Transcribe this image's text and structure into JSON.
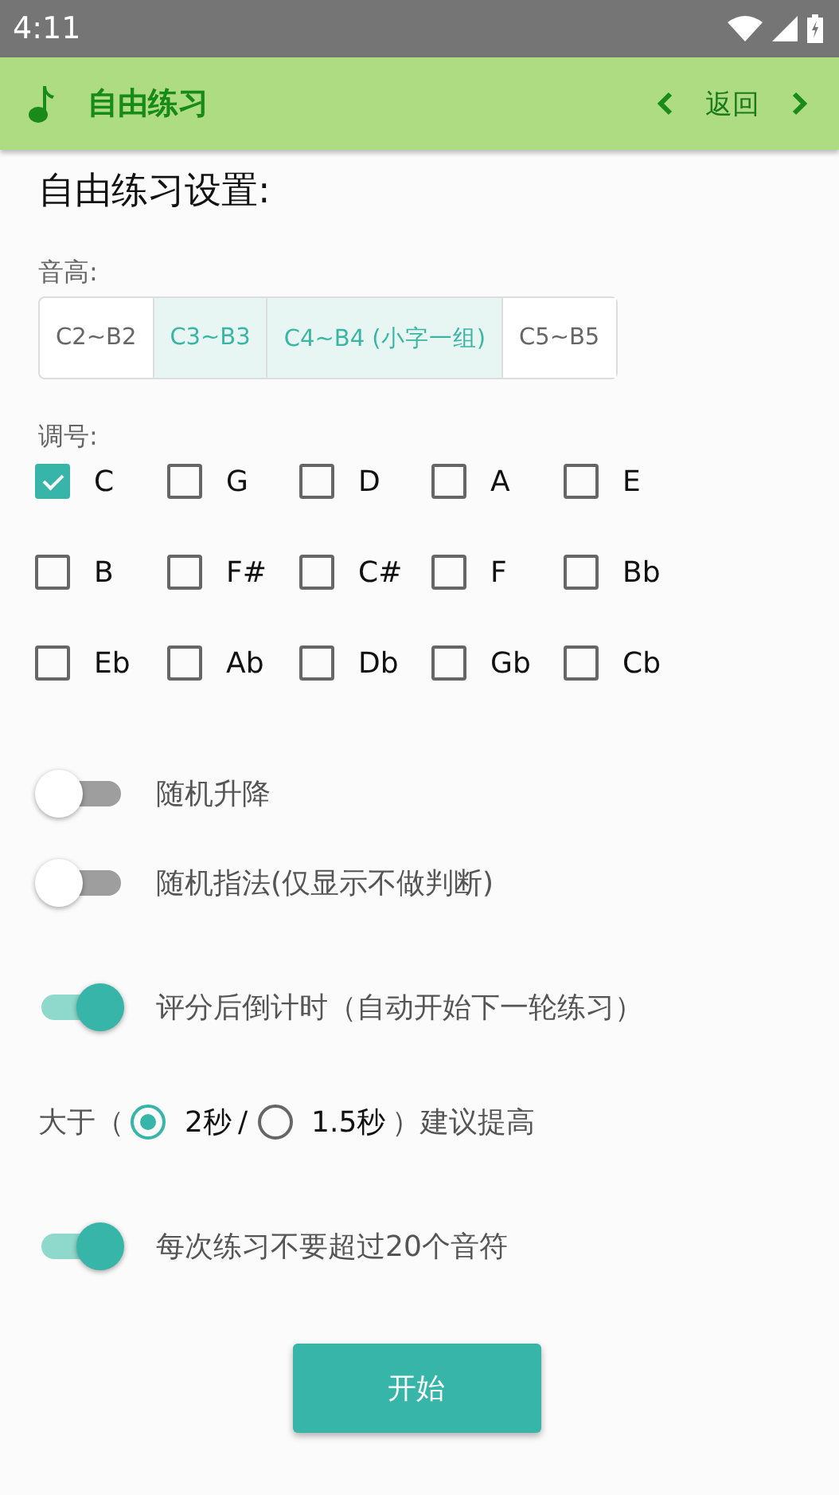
{
  "status_bar": {
    "time": "4:11"
  },
  "app_bar": {
    "title": "自由练习",
    "back": "返回"
  },
  "heading": "自由练习设置:",
  "pitch": {
    "label": "音高:",
    "segments": [
      {
        "label": "C2~B2",
        "selected": false
      },
      {
        "label": "C3~B3",
        "selected": true
      },
      {
        "label": "C4~B4 (小字一组)",
        "selected": true
      },
      {
        "label": "C5~B5",
        "selected": false
      }
    ]
  },
  "keys": {
    "label": "调号:",
    "items": [
      {
        "label": "C",
        "checked": true
      },
      {
        "label": "G",
        "checked": false
      },
      {
        "label": "D",
        "checked": false
      },
      {
        "label": "A",
        "checked": false
      },
      {
        "label": "E",
        "checked": false
      },
      {
        "label": "B",
        "checked": false
      },
      {
        "label": "F#",
        "checked": false
      },
      {
        "label": "C#",
        "checked": false
      },
      {
        "label": "F",
        "checked": false
      },
      {
        "label": "Bb",
        "checked": false
      },
      {
        "label": "Eb",
        "checked": false
      },
      {
        "label": "Ab",
        "checked": false
      },
      {
        "label": "Db",
        "checked": false
      },
      {
        "label": "Gb",
        "checked": false
      },
      {
        "label": "Cb",
        "checked": false
      }
    ]
  },
  "options": [
    {
      "kind": "toggle",
      "label": "随机升降",
      "on": false
    },
    {
      "kind": "toggle",
      "label": "随机指法(仅显示不做判断)",
      "on": false
    },
    {
      "kind": "toggle",
      "label": "评分后倒计时（自动开始下一轮练习）",
      "on": true
    },
    {
      "kind": "radio",
      "prefix": "大于（",
      "separator": "/",
      "suffix": "）建议提高",
      "choices": [
        {
          "label": "2秒",
          "selected": true
        },
        {
          "label": "1.5秒",
          "selected": false
        }
      ]
    },
    {
      "kind": "toggle",
      "label": "每次练习不要超过20个音符",
      "on": true
    }
  ],
  "start_button": "开始"
}
